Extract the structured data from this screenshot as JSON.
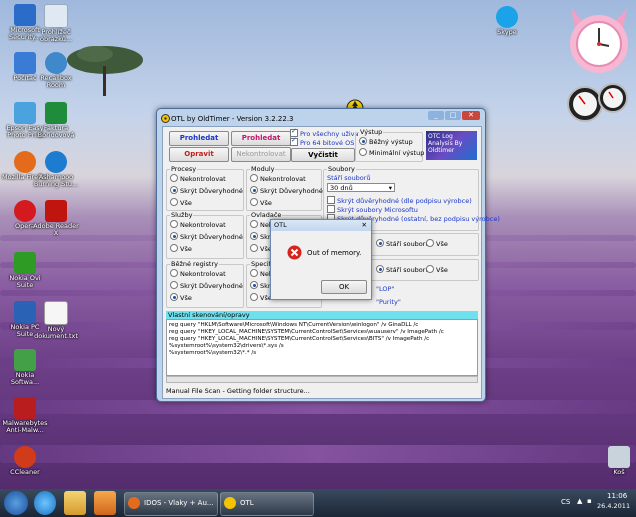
{
  "desktop": {
    "icons": [
      {
        "label": "Microsoft Security...",
        "color": "#2a6cc7"
      },
      {
        "label": "Prohlížeč obrázků...",
        "color": "#dfe8f3"
      },
      {
        "label": "Počítač",
        "color": "#3a7bd5"
      },
      {
        "label": "Recallbox Room",
        "color": "#3f88c9"
      },
      {
        "label": "Epson Easy Photo Print",
        "color": "#4aa3df"
      },
      {
        "label": "Faktura Bořidovová",
        "color": "#1e8c3a"
      },
      {
        "label": "Mozilla Firefox",
        "color": "#e36b1b"
      },
      {
        "label": "Ashampoo Burning Stu...",
        "color": "#1d7bd0"
      },
      {
        "label": "Opera",
        "color": "#d4191f"
      },
      {
        "label": "Adobe Reader X",
        "color": "#c0150f"
      },
      {
        "label": "Nokia Ovi Suite",
        "color": "#2e9b24"
      },
      {
        "label": "Nokia PC Suite",
        "color": "#2a62b5"
      },
      {
        "label": "Nový dokument.txt",
        "color": "#f6f6f6"
      },
      {
        "label": "Nokia Softwa...",
        "color": "#43a047"
      },
      {
        "label": "Malwarebytes Anti-Malw...",
        "color": "#b91d1d"
      },
      {
        "label": "CCleaner",
        "color": "#d23b1a"
      },
      {
        "label": "Skype",
        "color": "#1aa3e8"
      },
      {
        "label": "Koš",
        "color": "#c9d3dc"
      }
    ]
  },
  "otl": {
    "title": "OTL by OldTimer - Version 3.2.22.3",
    "btn_scan": "Prohledat",
    "btn_quickscan": "Prohledat rychle",
    "btn_fix": "Opravit",
    "btn_nocheck": "Nekontrolovat",
    "chk_allusers": "Pro všechny uživatele",
    "chk_64bit": "Pro 64 bitové OS",
    "btn_clean": "Vyčistit",
    "output": {
      "title": "Výstup",
      "standard": "Běžný výstup",
      "minimal": "Minimální výstup"
    },
    "logo": "OTC Log Analysis By Oldtimer",
    "processes": {
      "title": "Procesy",
      "opt1": "Nekontrolovat",
      "opt2": "Skrýt Důveryhodné",
      "opt3": "Vše"
    },
    "modules": {
      "title": "Moduly",
      "opt1": "Nekontrolovat",
      "opt2": "Skrýt Důveryhodné",
      "opt3": "Vše"
    },
    "files": {
      "title": "Soubory",
      "age_label": "Stáří souborů",
      "age_value": "30 dnů",
      "chk1": "Skrýt důvěryhodné (dle podpisu výrobce)",
      "chk2": "Skrýt soubory Microsoftu",
      "chk3": "Skrýt důvěryhodné (ostatní, bez podpisu výrobce)",
      "row_opt1": "Stáří souborů",
      "row_opt2": "Vše",
      "row2_opt1": "Stáří souborů",
      "row2_opt2": "Vše",
      "lop": "LOP",
      "purity": "Purity"
    },
    "services": {
      "title": "Služby",
      "opt1": "Nekontrolovat",
      "opt2": "Skrýt Důveryhodné",
      "opt3": "Vše"
    },
    "drivers": {
      "title": "Ovladače",
      "opt1": "Nekont",
      "opt2": "Skrýt D",
      "opt3": "Vše"
    },
    "registry": {
      "title": "Běžné registry",
      "opt1": "Nekontrolovat",
      "opt2": "Skrýt Důveryhodné",
      "opt3": "Vše"
    },
    "specific": {
      "title": "Specifické",
      "opt1": "Nekont",
      "opt2": "Skrýt D",
      "opt3": "Vše"
    },
    "custom_scan_label": "Vlastní skenování/opravy",
    "custom_lines": [
      "reg query \"HKLM\\Software\\Microsoft\\Windows NT\\CurrentVersion\\winlogon\" /v GinaDLL /c",
      "reg query \"HKEY_LOCAL_MACHINE\\SYSTEM\\CurrentControlSet\\Services\\wuauserv\" /v ImagePath /c",
      "reg query \"HKEY_LOCAL_MACHINE\\SYSTEM\\CurrentControlSet\\Services\\BITS\" /v ImagePath /c",
      "%systemroot%\\system32\\drivers\\*.sys /s",
      "%systemroot%\\system32\\*.* /s"
    ],
    "status": "Manual File Scan - Getting folder structure..."
  },
  "dialog": {
    "title": "OTL",
    "message": "Out of memory.",
    "ok": "OK"
  },
  "taskbar": {
    "task1": "IDOS - Vlaky + Au...",
    "task2": "OTL",
    "lang": "CS",
    "time": "11:06",
    "date": "26.4.2011"
  }
}
